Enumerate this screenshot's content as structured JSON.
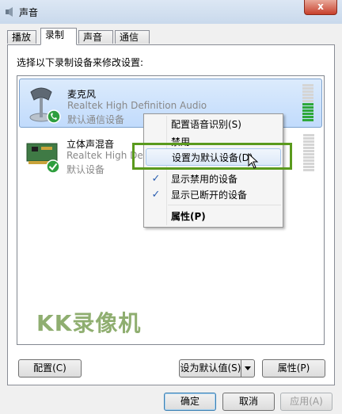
{
  "window": {
    "title": "声音",
    "close_glyph": "x"
  },
  "tabs": [
    {
      "label": "播放"
    },
    {
      "label": "录制",
      "active": true
    },
    {
      "label": "声音"
    },
    {
      "label": "通信"
    }
  ],
  "instruction": "选择以下录制设备来修改设置:",
  "devices": [
    {
      "name": "麦克风",
      "driver": "Realtek High Definition Audio",
      "status": "默认通信设备",
      "icon": "microphone-icon",
      "badge": "phone-badge-icon",
      "selected": true,
      "level_bars_lit": 6,
      "level_bars_total": 12
    },
    {
      "name": "立体声混音",
      "driver": "Realtek High Definition Audio",
      "status": "默认设备",
      "icon": "sound-card-icon",
      "badge": "checkmark-badge-icon",
      "selected": false,
      "level_bars_lit": 0,
      "level_bars_total": 12
    }
  ],
  "context_menu": {
    "items": [
      {
        "label": "配置语音识别(S)"
      },
      {
        "label": "禁用"
      },
      {
        "label": "设置为默认设备(D)",
        "hover": true
      },
      {
        "label": "显示禁用的设备",
        "checked": true
      },
      {
        "label": "显示已断开的设备",
        "checked": true
      },
      {
        "label": "属性(P)",
        "bold": true
      }
    ],
    "check_glyph": "✓"
  },
  "watermark": "KK录像机",
  "buttons": {
    "configure": "配置(C)",
    "set_default": "设为默认值(S)",
    "properties": "属性(P)",
    "ok": "确定",
    "cancel": "取消",
    "apply": "应用(A)"
  },
  "colors": {
    "highlight_box": "#5a9a1d",
    "selection": "#c1dbfc",
    "meter_on": "#2fa83a"
  }
}
